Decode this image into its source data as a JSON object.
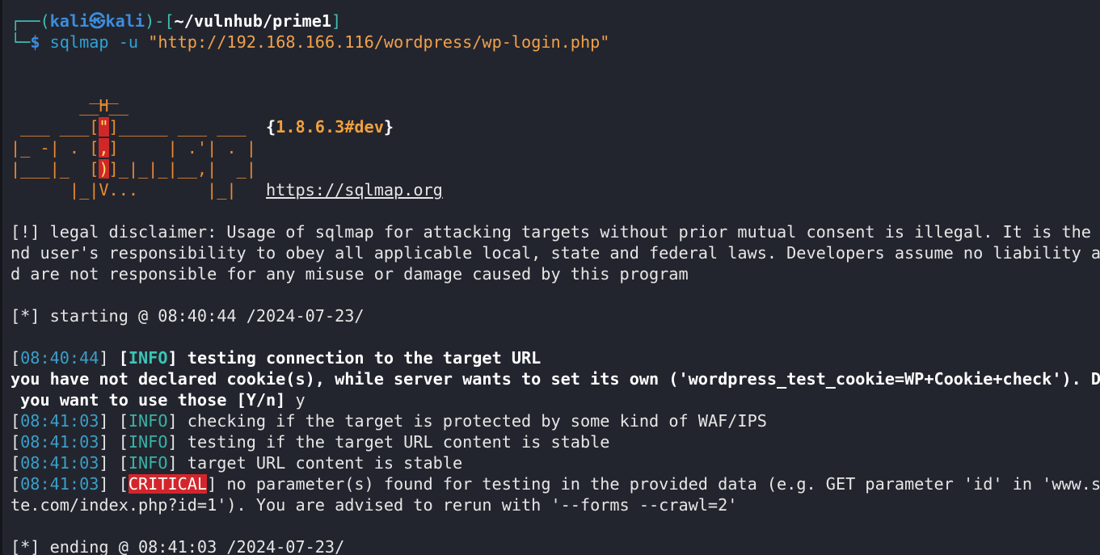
{
  "prompt": {
    "corner_top": "┌──",
    "paren_open": "(",
    "user": "kali",
    "at_symbol": "㉿",
    "host": "kali",
    "paren_close": ")",
    "dash": "-",
    "bracket_open": "[",
    "path": "~/vulnhub/prime1",
    "bracket_close": "]",
    "corner_bottom": "└─",
    "dollar": "$",
    "command": "sqlmap",
    "flag": "-u",
    "argument": "\"http://192.168.166.116/wordpress/wp-login.php\""
  },
  "banner": {
    "row1": "        ___",
    "row2": "       __H__",
    "row3_a": " ___ ___[",
    "row3_red": "\"",
    "row3_b": "]_____ ___ ___  ",
    "version": "{1.8.6.3#dev}",
    "row4_a": "|_ -| . [",
    "row4_red": ",",
    "row4_b": "]     | .'| . |",
    "row5_a": "|___|_  [",
    "row5_red": ")",
    "row5_b": "]_|_|_|__,|  _|",
    "row6": "      |_|V...       |_|   ",
    "website": "https://sqlmap.org"
  },
  "disclaimer": [
    "[!] legal disclaimer: Usage of sqlmap for attacking targets without prior mutual consent is illegal. It is the e",
    "nd user's responsibility to obey all applicable local, state and federal laws. Developers assume no liability an",
    "d are not responsible for any misuse or damage caused by this program"
  ],
  "starting": "[*] starting @ 08:40:44 /2024-07-23/",
  "log": [
    {
      "time": "08:40:44",
      "level": "INFO",
      "message": "testing connection to the target URL"
    },
    {
      "time": "08:41:03",
      "level": "INFO",
      "message": "checking if the target is protected by some kind of WAF/IPS"
    },
    {
      "time": "08:41:03",
      "level": "INFO",
      "message": "testing if the target URL content is stable"
    },
    {
      "time": "08:41:03",
      "level": "INFO",
      "message": "target URL content is stable"
    },
    {
      "time": "08:41:03",
      "level": "CRITICAL",
      "message": "no parameter(s) found for testing in the provided data (e.g. GET parameter 'id' in 'www.si"
    }
  ],
  "cookie_question": [
    "you have not declared cookie(s), while server wants to set its own ('wordpress_test_cookie=WP+Cookie+check'). Do",
    " you want to use those [Y/n] "
  ],
  "cookie_answer": "y",
  "critical_continuation": "te.com/index.php?id=1'). You are advised to rerun with '--forms --crawl=2'",
  "ending": "[*] ending @ 08:41:03 /2024-07-23/",
  "colors": {
    "background": "#23252e",
    "prompt_blue": "#3c8dde",
    "prompt_teal": "#3dbdb3",
    "banner_orange": "#ec8a2e",
    "info": "#39b3a8",
    "critical_bg": "#d2262c"
  }
}
